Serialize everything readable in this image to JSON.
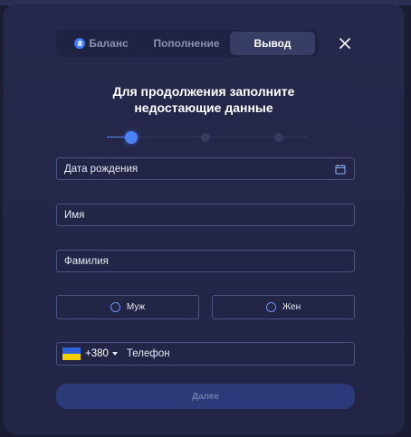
{
  "tabs": [
    {
      "label": "Баланс",
      "icon": "coin-icon",
      "active": false
    },
    {
      "label": "Пополнение",
      "active": false
    },
    {
      "label": "Вывод",
      "active": true
    }
  ],
  "coin_glyph": "₴",
  "heading": {
    "line1": "Для продолжения заполните",
    "line2": "недостающие данные"
  },
  "stepper": {
    "total_steps": 3,
    "current_step": 1
  },
  "form": {
    "birth_date_label": "Дата рождения",
    "first_name_label": "Имя",
    "last_name_label": "Фамилия",
    "gender_male_label": "Муж",
    "gender_female_label": "Жен",
    "phone_code": "+380",
    "phone_label": "Телефон",
    "submit_label": "Далее"
  },
  "colors": {
    "accent": "#3d7bf5",
    "modal_background": "#25284a",
    "field_border": "#4d5482",
    "submit_background": "#2c3a7a"
  }
}
